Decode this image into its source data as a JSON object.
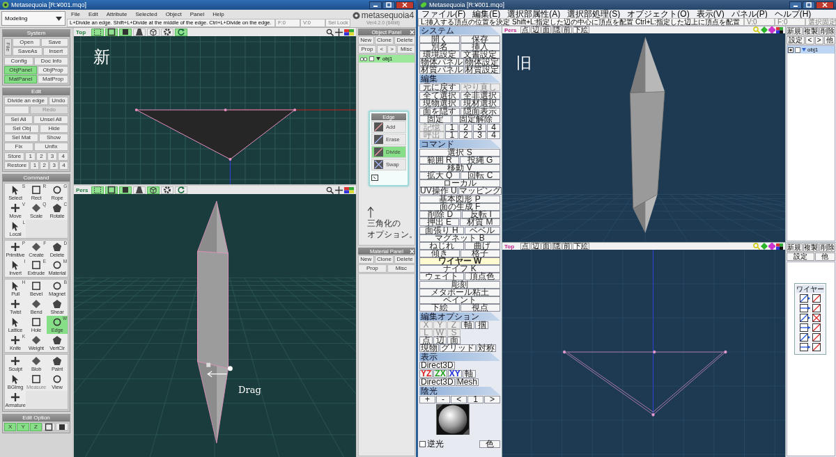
{
  "left_window": {
    "title": "Metasequoia [R:¥001.mqo]",
    "mode": "Modeling",
    "menu": [
      "File",
      "Edit",
      "Attribute",
      "Selected",
      "Object",
      "Panel",
      "Help"
    ],
    "status": "L+Divide an edge.  Shift+L+Divide at the middle of the edge.  Ctrl+L+Divide on the edge.",
    "fields": [
      "F:0",
      "V:0",
      "Sel Lock"
    ],
    "logo": "metasequoia4",
    "version": "Ver4.2.0 (64bit)",
    "side_panels": [
      {
        "title": "System",
        "kind": "buttons",
        "blocks": [
          {
            "side_label": "File",
            "rows": [
              {
                "buttons": [
                  {
                    "label": "Open",
                    "on": false,
                    "disabled": false
                  },
                  {
                    "label": "Save",
                    "on": false,
                    "disabled": false
                  }
                ]
              },
              {
                "buttons": [
                  {
                    "label": "SaveAs",
                    "on": false,
                    "disabled": false
                  },
                  {
                    "label": "Insert",
                    "on": false,
                    "disabled": false
                  }
                ]
              }
            ]
          },
          {
            "rows": [
              {
                "buttons": [
                  {
                    "label": "Config",
                    "on": false,
                    "disabled": false
                  },
                  {
                    "label": "Doc Info",
                    "on": false,
                    "disabled": false
                  }
                ]
              },
              {
                "buttons": [
                  {
                    "label": "ObjPanel",
                    "on": true,
                    "disabled": false
                  },
                  {
                    "label": "ObjProp",
                    "on": false,
                    "disabled": false
                  }
                ]
              },
              {
                "buttons": [
                  {
                    "label": "MatPanel",
                    "on": true,
                    "disabled": false
                  },
                  {
                    "label": "MatProp",
                    "on": false,
                    "disabled": false
                  }
                ]
              }
            ]
          }
        ]
      },
      {
        "title": "Edit",
        "kind": "buttons",
        "blocks": [
          {
            "rows": [
              {
                "buttons": [
                  {
                    "label": "Divide an edge",
                    "on": false,
                    "disabled": false
                  },
                  {
                    "label": "Undo",
                    "on": false,
                    "disabled": false
                  }
                ]
              },
              {
                "buttons": [
                  {
                    "on": false,
                    "disabled": false
                  },
                  {
                    "label": "Redo",
                    "on": false,
                    "disabled": true
                  }
                ]
              }
            ]
          },
          {
            "rows": [
              {
                "buttons": [
                  {
                    "label": "Sel All",
                    "on": false,
                    "disabled": false
                  },
                  {
                    "label": "Unsel All",
                    "on": false,
                    "disabled": false
                  }
                ]
              },
              {
                "buttons": [
                  {
                    "label": "Sel Obj",
                    "on": false,
                    "disabled": false
                  },
                  {
                    "label": "Hide",
                    "on": false,
                    "disabled": false
                  }
                ]
              },
              {
                "buttons": [
                  {
                    "label": "Sel Mat",
                    "on": false,
                    "disabled": false
                  },
                  {
                    "label": "Show",
                    "on": false,
                    "disabled": false
                  }
                ]
              },
              {
                "buttons": [
                  {
                    "label": "Fix",
                    "on": false,
                    "disabled": false
                  },
                  {
                    "label": "Unfix",
                    "on": false,
                    "disabled": false
                  }
                ]
              }
            ]
          },
          {
            "rows": [
              {
                "buttons": [
                  {
                    "label": "Store",
                    "on": false,
                    "disabled": false
                  },
                  {
                    "label": "1",
                    "on": false,
                    "disabled": false
                  },
                  {
                    "label": "2",
                    "on": false,
                    "disabled": false
                  },
                  {
                    "label": "3",
                    "on": false,
                    "disabled": false
                  },
                  {
                    "label": "4",
                    "on": false,
                    "disabled": false
                  }
                ]
              },
              {
                "buttons": [
                  {
                    "label": "Restore",
                    "on": false,
                    "disabled": false
                  },
                  {
                    "label": "1",
                    "on": false,
                    "disabled": false
                  },
                  {
                    "label": "2",
                    "on": false,
                    "disabled": false
                  },
                  {
                    "label": "3",
                    "on": false,
                    "disabled": false
                  },
                  {
                    "label": "4",
                    "on": false,
                    "disabled": false
                  }
                ]
              }
            ]
          }
        ]
      },
      {
        "title": "Command",
        "kind": "tools",
        "groups": [
          {
            "tools": [
              {
                "label": "Select",
                "key": "S",
                "on": false,
                "disabled": false
              },
              {
                "label": "Rect",
                "key": "R",
                "on": false,
                "disabled": false
              },
              {
                "label": "Rope",
                "key": "G",
                "on": false,
                "disabled": false
              },
              {
                "label": "Move",
                "key": "V",
                "on": false,
                "disabled": false
              },
              {
                "label": "Scale",
                "key": "Q",
                "on": false,
                "disabled": false
              },
              {
                "label": "Rotate",
                "key": "C",
                "on": false,
                "disabled": false
              },
              {
                "label": "Local",
                "key": "L",
                "on": false,
                "disabled": false
              }
            ]
          },
          {
            "tools": [
              {
                "label": "Primitive",
                "key": "P",
                "on": false,
                "disabled": false
              },
              {
                "label": "Create",
                "key": "F",
                "on": false,
                "disabled": false
              },
              {
                "label": "Delete",
                "key": "D",
                "on": false,
                "disabled": false
              },
              {
                "label": "Invert",
                "key": "I",
                "on": false,
                "disabled": false
              },
              {
                "label": "Extrude",
                "key": "E",
                "on": false,
                "disabled": false
              },
              {
                "label": "Material",
                "key": "M",
                "on": false,
                "disabled": false
              }
            ]
          },
          {
            "tools": [
              {
                "label": "Pull",
                "key": "H",
                "on": false,
                "disabled": false
              },
              {
                "label": "Bevel",
                "on": false,
                "disabled": false
              },
              {
                "label": "Magnet",
                "key": "B",
                "on": false,
                "disabled": false
              },
              {
                "label": "Twist",
                "on": false,
                "disabled": false
              },
              {
                "label": "Bend",
                "on": false,
                "disabled": false
              },
              {
                "label": "Shear",
                "on": false,
                "disabled": false
              },
              {
                "label": "Lattice",
                "on": false,
                "disabled": false
              },
              {
                "label": "Hole",
                "on": false,
                "disabled": false
              },
              {
                "label": "Edge",
                "key": "W",
                "on": true,
                "disabled": false
              },
              {
                "label": "Knife",
                "key": "K",
                "on": false,
                "disabled": false
              },
              {
                "label": "Weight",
                "on": false,
                "disabled": false
              },
              {
                "label": "VertClr",
                "on": false,
                "disabled": false
              }
            ]
          },
          {
            "tools": [
              {
                "label": "Sculpt",
                "on": false,
                "disabled": false
              },
              {
                "label": "Blob",
                "on": false,
                "disabled": false
              },
              {
                "label": "Paint",
                "on": false,
                "disabled": false
              },
              {
                "label": "BGImg",
                "on": false,
                "disabled": false
              },
              {
                "label": "Measure",
                "on": false,
                "disabled": true
              },
              {
                "label": "View",
                "on": false,
                "disabled": false
              },
              {
                "label": "Armature",
                "on": false,
                "disabled": false
              }
            ]
          }
        ]
      },
      {
        "title": "Edit Option",
        "kind": "options",
        "blocks": [
          {
            "rows": [
              {
                "buttons": [
                  {
                    "label": "X",
                    "on": true,
                    "disabled": false
                  },
                  {
                    "label": "Y",
                    "on": true,
                    "disabled": false
                  },
                  {
                    "label": "Z",
                    "on": true,
                    "disabled": false
                  }
                ]
              }
            ]
          }
        ]
      }
    ],
    "views": [
      {
        "label": "Top",
        "tools": [
          {
            "on": true
          },
          {
            "on": true
          },
          {
            "on": true
          },
          {
            "on": false
          },
          {
            "on": false
          },
          {
            "on": false
          },
          {
            "on": true
          }
        ],
        "kind": "top",
        "annotation": "新"
      },
      {
        "label": "Pers",
        "tools": [
          {
            "on": true
          },
          {
            "on": true
          },
          {
            "on": true
          },
          {
            "on": false
          },
          {
            "on": true
          },
          {
            "on": false
          },
          {
            "on": false
          }
        ],
        "kind": "pers",
        "annotation": "Drag"
      }
    ],
    "object_panel": {
      "title": "Object Panel",
      "buttons_top": [
        "New",
        "Clone",
        "Delete"
      ],
      "buttons_bottom": [
        "Prop",
        "<",
        ">",
        "Misc"
      ],
      "objects": [
        {
          "name": "obj1",
          "selected": true
        }
      ],
      "edge_panel": {
        "title": "Edge",
        "items": [
          {
            "label": "Add",
            "selected": false
          },
          {
            "label": "Erase",
            "selected": false
          },
          {
            "label": "Divide",
            "selected": true
          },
          {
            "label": "Swap",
            "selected": false
          }
        ]
      },
      "annotation": [
        "三角化の",
        "オプション。"
      ]
    },
    "material_panel": {
      "title": "Material Panel",
      "buttons_top": [
        "New",
        "Clone",
        "Delete"
      ],
      "buttons_bottom": [
        "Prop",
        "Misc"
      ]
    }
  },
  "right_window": {
    "title": "Metasequoia [R:¥001.mqo]",
    "menu": [
      "ファイル(F)",
      "編集(E)",
      "選択部属性(A)",
      "選択部処理(S)",
      "オブジェクト(O)",
      "表示(V)",
      "パネル(P)",
      "ヘルプ(H)"
    ],
    "status": "L:挿入する頂点の位置を決定  Shift+L:指定した辺の中心に頂点を配置  Ctrl+L:指定した辺上に頂点を配置",
    "fields": [
      "V:0",
      "F:0",
      "選択固定"
    ],
    "side_sections": [
      {
        "title": "システム",
        "kind": "stack",
        "blocks": [
          {
            "rows": [
              {
                "buttons": [
                  {
                    "label": "開く",
                    "on": false,
                    "disabled": false
                  },
                  {
                    "label": "保存",
                    "on": false,
                    "disabled": false
                  }
                ]
              },
              {
                "buttons": [
                  {
                    "label": "別名",
                    "on": false,
                    "disabled": false
                  },
                  {
                    "label": "挿入",
                    "on": false,
                    "disabled": false
                  }
                ]
              },
              {
                "buttons": [
                  {
                    "label": "環境設定",
                    "on": false,
                    "disabled": false
                  },
                  {
                    "label": "文書設定",
                    "on": false,
                    "disabled": false
                  }
                ]
              },
              {
                "buttons": [
                  {
                    "label": "物体パネル",
                    "on": false,
                    "disabled": false
                  },
                  {
                    "label": "物体設定",
                    "on": false,
                    "disabled": false
                  }
                ]
              },
              {
                "buttons": [
                  {
                    "label": "材質パネル",
                    "on": false,
                    "disabled": false
                  },
                  {
                    "label": "材質設定",
                    "on": false,
                    "disabled": false
                  }
                ]
              }
            ]
          }
        ]
      },
      {
        "title": "編集",
        "kind": "stack",
        "blocks": [
          {
            "rows": [
              {
                "buttons": [
                  {
                    "label": "元に戻す",
                    "on": false,
                    "disabled": false
                  },
                  {
                    "label": "やり直し",
                    "on": false,
                    "disabled": true
                  }
                ]
              }
            ]
          },
          {
            "rows": [
              {
                "buttons": [
                  {
                    "label": "全て選択",
                    "on": false,
                    "disabled": false
                  },
                  {
                    "label": "全非選択",
                    "on": false,
                    "disabled": false
                  }
                ]
              },
              {
                "buttons": [
                  {
                    "label": "現物選択",
                    "on": false,
                    "disabled": false
                  },
                  {
                    "label": "現材選択",
                    "on": false,
                    "disabled": false
                  }
                ]
              }
            ]
          },
          {
            "rows": [
              {
                "buttons": [
                  {
                    "label": "面を隠す",
                    "on": false,
                    "disabled": false
                  },
                  {
                    "label": "隠面表示",
                    "on": false,
                    "disabled": false
                  }
                ]
              },
              {
                "buttons": [
                  {
                    "label": "固定",
                    "on": false,
                    "disabled": false
                  },
                  {
                    "label": "固定解除",
                    "on": false,
                    "disabled": false
                  }
                ]
              }
            ]
          },
          {
            "rows": [
              {
                "buttons": [
                  {
                    "label": "記憶",
                    "on": false,
                    "disabled": true
                  },
                  {
                    "label": "1",
                    "on": false,
                    "disabled": false
                  },
                  {
                    "label": "2",
                    "on": false,
                    "disabled": false
                  },
                  {
                    "label": "3",
                    "on": false,
                    "disabled": false
                  },
                  {
                    "label": "4",
                    "on": false,
                    "disabled": false
                  }
                ]
              },
              {
                "buttons": [
                  {
                    "label": "呼出",
                    "on": false,
                    "disabled": true
                  },
                  {
                    "label": "1",
                    "on": false,
                    "disabled": false
                  },
                  {
                    "label": "2",
                    "on": false,
                    "disabled": false
                  },
                  {
                    "label": "3",
                    "on": false,
                    "disabled": false
                  },
                  {
                    "label": "4",
                    "on": false,
                    "disabled": false
                  }
                ]
              }
            ]
          }
        ]
      },
      {
        "title": "コマンド",
        "kind": "stack",
        "blocks": [
          {
            "rows": [
              {
                "buttons": [
                  {
                    "label": "選択 S",
                    "on": false,
                    "disabled": false
                  }
                ]
              },
              {
                "buttons": [
                  {
                    "label": "範囲 R",
                    "on": false,
                    "disabled": false
                  },
                  {
                    "label": "投縄 G",
                    "on": false,
                    "disabled": false
                  }
                ]
              },
              {
                "buttons": [
                  {
                    "label": "移動 V",
                    "on": false,
                    "disabled": false
                  }
                ]
              },
              {
                "buttons": [
                  {
                    "label": "拡大 Q",
                    "on": false,
                    "disabled": false
                  },
                  {
                    "label": "回転 C",
                    "on": false,
                    "disabled": false
                  }
                ]
              },
              {
                "buttons": [
                  {
                    "label": "ローカル",
                    "on": false,
                    "disabled": false
                  }
                ]
              },
              {
                "buttons": [
                  {
                    "label": "UV操作 U",
                    "on": false,
                    "disabled": false
                  },
                  {
                    "label": "マッピング",
                    "on": false,
                    "disabled": false
                  }
                ]
              }
            ]
          },
          {
            "rows": [
              {
                "buttons": [
                  {
                    "label": "基本図形 P",
                    "on": false,
                    "disabled": false
                  }
                ]
              },
              {
                "buttons": [
                  {
                    "label": "面の生成 F",
                    "on": false,
                    "disabled": false
                  }
                ]
              },
              {
                "buttons": [
                  {
                    "label": "削除 D",
                    "on": false,
                    "disabled": false
                  },
                  {
                    "label": "反転 I",
                    "on": false,
                    "disabled": false
                  }
                ]
              },
              {
                "buttons": [
                  {
                    "label": "押出 E",
                    "on": false,
                    "disabled": false
                  },
                  {
                    "label": "材質 M",
                    "on": false,
                    "disabled": false
                  }
                ]
              }
            ]
          },
          {
            "rows": [
              {
                "buttons": [
                  {
                    "label": "面張り H",
                    "on": false,
                    "disabled": false
                  },
                  {
                    "label": "ベベル",
                    "on": false,
                    "disabled": false
                  }
                ]
              },
              {
                "buttons": [
                  {
                    "label": "マグネット B",
                    "on": false,
                    "disabled": false
                  }
                ]
              },
              {
                "buttons": [
                  {
                    "label": "ねじれ",
                    "on": false,
                    "disabled": false
                  },
                  {
                    "label": "曲げ",
                    "on": false,
                    "disabled": false
                  }
                ]
              },
              {
                "buttons": [
                  {
                    "label": "傾き",
                    "on": false,
                    "disabled": false
                  },
                  {
                    "label": "格子",
                    "on": false,
                    "disabled": false
                  }
                ]
              },
              {
                "buttons": [
                  {
                    "label": "ワイヤー W",
                    "on": true,
                    "disabled": false
                  }
                ]
              },
              {
                "buttons": [
                  {
                    "label": "ナイフ K",
                    "on": false,
                    "disabled": false
                  }
                ]
              },
              {
                "buttons": [
                  {
                    "label": "ウェイト",
                    "on": false,
                    "disabled": false
                  },
                  {
                    "label": "頂点色",
                    "on": false,
                    "disabled": false
                  }
                ]
              }
            ]
          },
          {
            "rows": [
              {
                "buttons": [
                  {
                    "label": "彫刻",
                    "on": false,
                    "disabled": false
                  }
                ]
              },
              {
                "buttons": [
                  {
                    "label": "メタボール粘土",
                    "on": false,
                    "disabled": false
                  }
                ]
              },
              {
                "buttons": [
                  {
                    "label": "ペイント",
                    "on": false,
                    "disabled": false
                  }
                ]
              },
              {
                "buttons": [
                  {
                    "label": "下絵",
                    "on": false,
                    "disabled": false
                  },
                  {
                    "label": "視点",
                    "on": false,
                    "disabled": false
                  }
                ]
              }
            ]
          }
        ]
      },
      {
        "title": "編集オプション",
        "kind": "grid",
        "blocks": [
          {
            "rows": [
              {
                "buttons": [
                  {
                    "label": "X",
                    "on": false,
                    "disabled": true
                  },
                  {
                    "label": "Y",
                    "on": false,
                    "disabled": true
                  },
                  {
                    "label": "Z",
                    "on": false,
                    "disabled": true
                  },
                  {
                    "label": "軸",
                    "on": false,
                    "disabled": false
                  },
                  {
                    "label": "掴",
                    "on": false,
                    "disabled": false
                  }
                ]
              },
              {
                "buttons": [
                  {
                    "label": "L",
                    "on": false,
                    "disabled": true
                  },
                  {
                    "label": "W",
                    "on": false,
                    "disabled": true
                  },
                  {
                    "label": "S",
                    "on": false,
                    "disabled": true
                  }
                ]
              },
              {
                "buttons": [
                  {
                    "label": "点",
                    "on": false,
                    "disabled": false
                  },
                  {
                    "label": "辺",
                    "on": false,
                    "disabled": false
                  },
                  {
                    "label": "面",
                    "on": false,
                    "disabled": false
                  }
                ]
              },
              {
                "buttons": [
                  {
                    "label": "現物",
                    "on": false,
                    "disabled": false
                  },
                  {
                    "label": "グリッド",
                    "on": false,
                    "disabled": false
                  },
                  {
                    "label": "対称",
                    "on": false,
                    "disabled": false
                  }
                ]
              }
            ]
          }
        ]
      },
      {
        "title": "表示",
        "kind": "grid",
        "blocks": [
          {
            "rows": [
              {
                "buttons": [
                  {
                    "label": "Direct3D",
                    "on": false,
                    "disabled": false
                  }
                ]
              }
            ]
          },
          {
            "rows": [
              {
                "buttons": [
                  {
                    "label": "YZ",
                    "on": false,
                    "disabled": false,
                    "color": "#e02020"
                  },
                  {
                    "label": "ZX",
                    "on": false,
                    "disabled": false,
                    "color": "#20a020"
                  },
                  {
                    "label": "XY",
                    "on": false,
                    "disabled": false,
                    "color": "#2030e0"
                  },
                  {
                    "label": "軸",
                    "on": false,
                    "disabled": false
                  }
                ]
              }
            ]
          },
          {
            "rows": [
              {
                "buttons": [
                  {
                    "label": "Direct3D",
                    "on": false,
                    "disabled": false
                  },
                  {
                    "label": "Mesh",
                    "on": false,
                    "disabled": false
                  }
                ]
              }
            ]
          }
        ]
      }
    ],
    "light": {
      "title": "陰光",
      "buttons": [
        {
          "label": "+",
          "on": false,
          "disabled": false
        },
        {
          "label": "-",
          "on": false,
          "disabled": false
        },
        {
          "label": "<",
          "on": false,
          "disabled": false
        },
        {
          "label": "1",
          "on": false,
          "disabled": false
        },
        {
          "label": ">",
          "on": false,
          "disabled": false
        }
      ],
      "backlight": {
        "label": "逆光",
        "checked": false
      },
      "color_button": "色"
    },
    "views": [
      {
        "label": "Pers",
        "kind": "pers",
        "buttons": [
          "点",
          "辺",
          "面",
          "隠",
          "前",
          "下絵"
        ],
        "annotation": "旧"
      },
      {
        "label": "Top",
        "kind": "top",
        "buttons": [
          "点",
          "辺",
          "面",
          "隠",
          "前",
          "下絵"
        ]
      }
    ],
    "object_panel": {
      "buttons_top": [
        "新規",
        "複製",
        "削除"
      ],
      "buttons_bottom": [
        "設定",
        "<",
        ">",
        "他"
      ],
      "objects": [
        {
          "name": "obj1",
          "selected": true
        }
      ]
    },
    "material_panel": {
      "buttons_top": [
        "新規",
        "複製",
        "削除"
      ],
      "buttons_bottom": [
        "設定",
        "他"
      ],
      "wire_panel": {
        "title": "ワイヤー"
      }
    }
  }
}
